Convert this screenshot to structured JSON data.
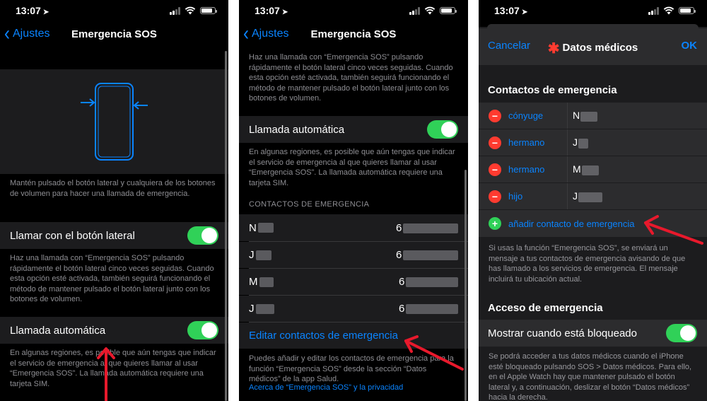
{
  "status": {
    "time": "13:07",
    "location_icon": "location-arrow-icon"
  },
  "screen1": {
    "back_label": "Ajustes",
    "title": "Emergencia SOS",
    "illustration_footer": "Mantén pulsado el botón lateral y cualquiera de los botones de volumen para hacer una llamada de emergencia.",
    "side_button_label": "Llamar con el botón lateral",
    "side_button_footer": "Haz una llamada con “Emergencia SOS” pulsando rápidamente el botón lateral cinco veces seguidas. Cuando esta opción esté activada, también seguirá funcionando el método de mantener pulsado el botón lateral junto con los botones de volumen.",
    "auto_call_label": "Llamada automática",
    "auto_call_footer": "En algunas regiones, es posible que aún tengas que indicar el servicio de emergencia al que quieres llamar al usar “Emergencia SOS”. La llamada automática requiere una tarjeta SIM."
  },
  "screen2": {
    "back_label": "Ajustes",
    "title": "Emergencia SOS",
    "top_footer": "Haz una llamada con “Emergencia SOS” pulsando rápidamente el botón lateral cinco veces seguidas. Cuando esta opción esté activada, también seguirá funcionando el método de mantener pulsado el botón lateral junto con los botones de volumen.",
    "auto_call_label": "Llamada automática",
    "auto_call_footer": "En algunas regiones, es posible que aún tengas que indicar el servicio de emergencia al que quieres llamar al usar “Emergencia SOS”. La llamada automática requiere una tarjeta SIM.",
    "contacts_header": "CONTACTOS DE EMERGENCIA",
    "contacts": [
      {
        "initial": "N",
        "phone_prefix": "6"
      },
      {
        "initial": "J",
        "phone_prefix": "6"
      },
      {
        "initial": "M",
        "phone_prefix": "6"
      },
      {
        "initial": "J",
        "phone_prefix": "6"
      }
    ],
    "edit_link": "Editar contactos de emergencia",
    "bottom_footer": "Puedes añadir y editar los contactos de emergencia para la función “Emergencia SOS” desde la sección “Datos médicos” de la app Salud.",
    "privacy_link": "Acerca de “Emergencia SOS” y la privacidad"
  },
  "screen3": {
    "cancel_label": "Cancelar",
    "title": "Datos médicos",
    "ok_label": "OK",
    "contacts_header": "Contactos de emergencia",
    "contacts": [
      {
        "relation": "cónyuge",
        "initial": "N"
      },
      {
        "relation": "hermano",
        "initial": "J"
      },
      {
        "relation": "hermano",
        "initial": "M"
      },
      {
        "relation": "hijo",
        "initial": "J"
      }
    ],
    "add_contact": "añadir contacto de emergencia",
    "contacts_footer": "Si usas la función “Emergencia SOS”, se enviará un mensaje a tus contactos de emergencia avisando de que has llamado a los servicios de emergencia. El mensaje incluirá tu ubicación actual.",
    "access_header": "Acceso de emergencia",
    "show_locked_label": "Mostrar cuando está bloqueado",
    "access_footer": "Se podrá acceder a tus datos médicos cuando el iPhone esté bloqueado pulsando SOS > Datos médicos. Para ello, en el Apple Watch hay que mantener pulsado el botón lateral y, a continuación, deslizar el botón “Datos médicos” hacia la derecha."
  },
  "colors": {
    "accent": "#0a84ff",
    "toggle_on": "#30d158",
    "annotation": "#e8192c",
    "destructive": "#ff3b30"
  }
}
